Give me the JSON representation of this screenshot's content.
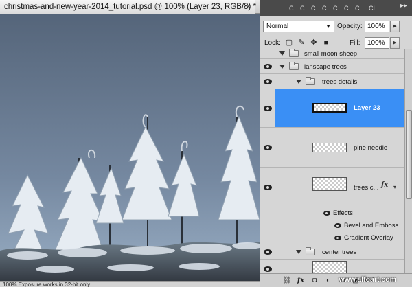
{
  "document": {
    "tab_title": "christmas-and-new-year-2014_tutorial.psd @ 100% (Layer 23, RGB/8) *",
    "close_glyph": "×",
    "status_text": "100%    Exposure works in 32-bit only"
  },
  "panel": {
    "tabs": [
      "C",
      "C",
      "C",
      "C",
      "C",
      "C",
      "C",
      "CL"
    ],
    "blend_mode": "Normal",
    "opacity_label": "Opacity:",
    "opacity_value": "100%",
    "lock_label": "Lock:",
    "fill_label": "Fill:",
    "fill_value": "100%",
    "layers": {
      "small_moon_sheep": "small moon sheep",
      "lanscape_trees": "lanscape trees",
      "trees_details": "trees details",
      "layer_23": "Layer 23",
      "pine_needle": "pine needle",
      "trees_c": "trees c...",
      "effects": "Effects",
      "bevel_emboss": "Bevel and Emboss",
      "gradient_overlay": "Gradient Overlay",
      "center_trees": "center trees"
    },
    "fx_label": "fx",
    "watermark": "www.alfoart.com"
  },
  "colors": {
    "selection": "#3a8ff5",
    "sky_top": "#56657a",
    "sky_bottom": "#8fa1b6"
  },
  "icons": [
    "close-icon",
    "chevron-down-icon",
    "lock-transparent-icon",
    "lock-brush-icon",
    "lock-move-icon",
    "lock-all-icon",
    "eye-icon",
    "folder-icon",
    "link-icon",
    "fx-icon",
    "mask-icon",
    "adjustment-icon",
    "new-group-icon",
    "new-layer-icon",
    "trash-icon"
  ]
}
